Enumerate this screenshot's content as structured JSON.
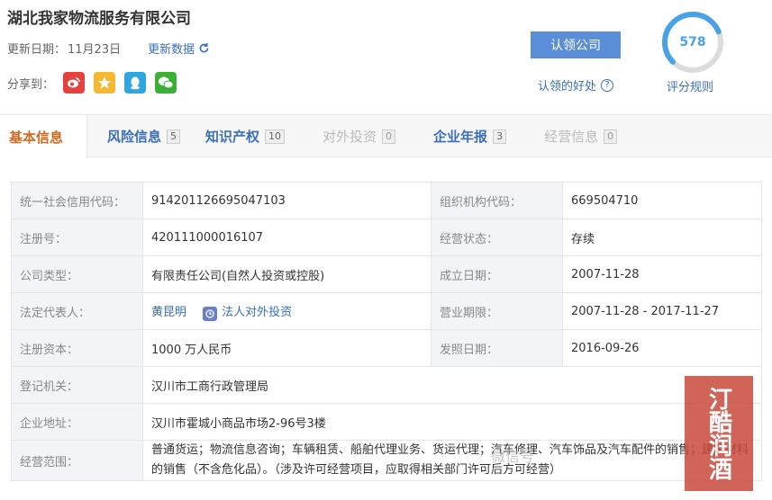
{
  "company": {
    "name": "湖北我家物流服务有限公司",
    "update_label": "更新日期：",
    "update_date": "11月23日",
    "refresh_label": "更新数据"
  },
  "share": {
    "label": "分享到：",
    "buttons": [
      "weibo-icon",
      "qzone-icon",
      "qq-icon",
      "wechat-icon"
    ]
  },
  "claim": {
    "button_label": "认领公司",
    "benefit_label": "认领的好处"
  },
  "score": {
    "value": "578",
    "rule_label": "评分规则",
    "fill": 0.75,
    "color": "#49a1e6"
  },
  "tabs": [
    {
      "label": "基本信息",
      "count": "",
      "state": "active"
    },
    {
      "label": "风险信息",
      "count": "5",
      "state": "normal"
    },
    {
      "label": "知识产权",
      "count": "10",
      "state": "normal"
    },
    {
      "label": "对外投资",
      "count": "0",
      "state": "disabled"
    },
    {
      "label": "企业年报",
      "count": "3",
      "state": "normal"
    },
    {
      "label": "经营信息",
      "count": "0",
      "state": "disabled"
    }
  ],
  "info": {
    "credit_code_label": "统一社会信用代码：",
    "credit_code": "914201126695047103",
    "org_code_label": "组织机构代码：",
    "org_code": "669504710",
    "reg_no_label": "注册号：",
    "reg_no": "420111000016107",
    "status_label": "经营状态：",
    "status": "存续",
    "type_label": "公司类型：",
    "type": "有限责任公司(自然人投资或控股)",
    "founded_label": "成立日期：",
    "founded": "2007-11-28",
    "legal_label": "法定代表人：",
    "legal_name": "黄昆明",
    "legal_invest": "法人对外投资",
    "term_label": "营业期限：",
    "term": "2007-11-28 - 2017-11-27",
    "capital_label": "注册资本：",
    "capital": "1000 万人民币",
    "issue_label": "发照日期：",
    "issue_date": "2016-09-26",
    "authority_label": "登记机关：",
    "authority": "汉川市工商行政管理局",
    "address_label": "企业地址：",
    "address": "汉川市霍城小商品市场2-96号3楼",
    "scope_label": "经营范围：",
    "scope": "普通货运；物流信息咨询；车辆租赁、船舶代理业务、货运代理；汽车修理、汽车饰品及汽车配件的销售；建筑材料的销售（不含危化品）。（涉及许可经营项目，应取得相关部门许可后方可经营）"
  },
  "watermark": {
    "seal_text": "汀酷润酒",
    "text": "微信号"
  }
}
